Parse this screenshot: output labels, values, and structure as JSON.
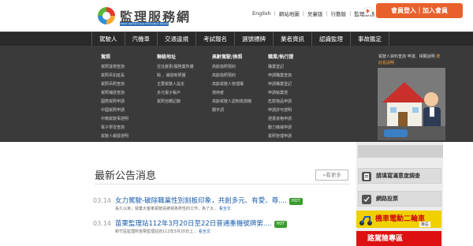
{
  "site": {
    "logo_title": "監理服務網",
    "logo_sub": "Motor Vehicle Driver Information Service"
  },
  "toplinks": [
    "English",
    "網站地圖",
    "兒童版",
    "行動版",
    "監理服務 APP"
  ],
  "login_button": "會員登入｜加入會員",
  "nav": [
    "駕駛人",
    "汽機車",
    "交通違規",
    "考試報名",
    "選號標牌",
    "業者資訊",
    "認識監理",
    "事故鑑定"
  ],
  "mega": {
    "columns": [
      {
        "heading": "駕照",
        "links": [
          "駕照違規查詢",
          "駕照吊扣延長",
          "駕照吊照查詢",
          "駕照補發查詢",
          "國際駕照申請",
          "中國駕照申請",
          "中籍駕駛事證明",
          "電子學習查詢",
          "駕駛人報廢證明"
        ]
      },
      {
        "heading": "聯絡地址",
        "links": [
          "住址變更/服務業所遷",
          "跨 、補發新照服",
          "主要駕駛人設定",
          "多元電子帳戶",
          "駕照自轉記錄"
        ]
      },
      {
        "heading": "高齡駕駛/換照",
        "links": [
          "高齡換照預約",
          "高齡換照預約",
          "高齡駕駛人管理權",
          "適用者",
          "高齡駕駛人認知檢測機",
          "關字詞"
        ]
      },
      {
        "heading": "職業/執行證",
        "links": [
          "職業登記",
          "申請職業查詢",
          "申請職業登記",
          "申請執業證",
          "危險物品申請",
          "申請許可證明",
          "證書資格申請",
          "動力機械申請",
          "駕照管理申請"
        ]
      }
    ],
    "ad_text": "駕駛人資料查詢 申請、相關說明",
    "ad_highlight": "按此看說明"
  },
  "news_section": {
    "title": "最新公告消息",
    "more_label": "看更多",
    "hot_label": "HOT",
    "more_link": "看全文",
    "items": [
      {
        "date": "03.14",
        "title": "女力駕駛-破除職業性別刻板印象，共創多元、有愛、尊....",
        "desc": "長久以來，營業大客車駕駛員被視為男性的工作，為了大..."
      },
      {
        "date": "03.14",
        "title": "苗栗監理站112年3月20日至22日普通重機號牌第....",
        "desc": "新竹區監理所苗栗監理站自112年3月20日上..."
      }
    ]
  },
  "right_col": {
    "survey_label": "請填寫滿意度調查",
    "vote_label": "網路投票",
    "banner1_text": "機車電動二輪車",
    "banner1_sub": "專區",
    "banner2_text": "路駕險專區"
  },
  "colors": {
    "accent": "#e8612c",
    "nav_bg": "#2a2a2a",
    "mega_bg": "#3a3a3a",
    "link": "#1a5dab",
    "hot": "#3a9b2e"
  }
}
